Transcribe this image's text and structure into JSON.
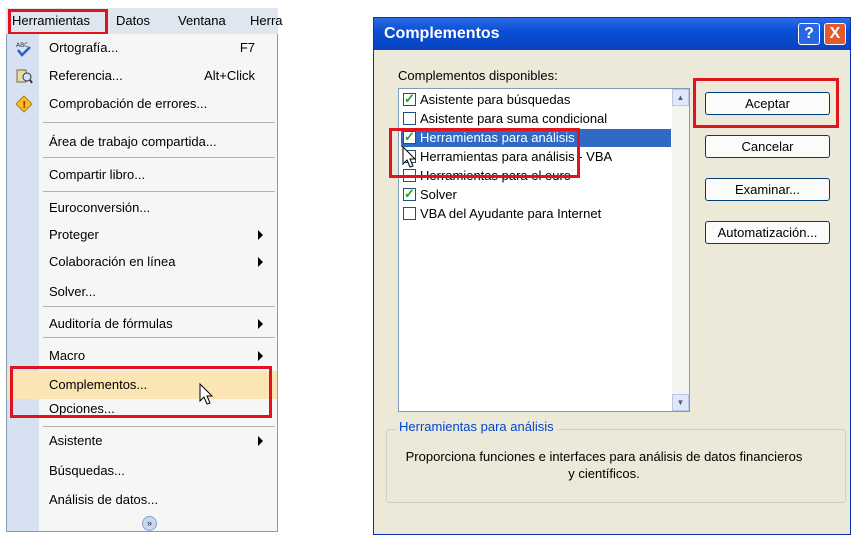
{
  "menubar": {
    "herramientas": "Herramientas",
    "datos": "Datos",
    "ventana": "Ventana",
    "truncated": "Herra"
  },
  "menu": {
    "items": [
      {
        "label": "Ortografía...",
        "shortcut": "F7",
        "icon": "spellcheck-icon"
      },
      {
        "label": "Referencia...",
        "shortcut": "Alt+Click",
        "icon": "research-icon"
      },
      {
        "label": "Comprobación de errores...",
        "icon": "error-check-icon"
      },
      {
        "label": "Área de trabajo compartida..."
      },
      {
        "label": "Compartir libro..."
      },
      {
        "label": "Euroconversión..."
      },
      {
        "label": "Proteger",
        "submenu": true
      },
      {
        "label": "Colaboración en línea",
        "submenu": true
      },
      {
        "label": "Solver..."
      },
      {
        "label": "Auditoría de fórmulas",
        "submenu": true
      },
      {
        "label": "Macro",
        "submenu": true
      },
      {
        "label": "Complementos..."
      },
      {
        "label": "Opciones..."
      },
      {
        "label": "Asistente",
        "submenu": true
      },
      {
        "label": "Búsquedas..."
      },
      {
        "label": "Análisis de datos..."
      }
    ],
    "expand_icon": "expand-menu-icon"
  },
  "dialog": {
    "title": "Complementos",
    "help": "?",
    "close": "X",
    "list_label": "Complementos disponibles:",
    "addins": [
      {
        "label": "Asistente para búsquedas",
        "checked": true
      },
      {
        "label": "Asistente para suma condicional",
        "checked": false
      },
      {
        "label": "Herramientas para análisis",
        "checked": true,
        "selected": true
      },
      {
        "label": "Herramientas para análisis - VBA",
        "checked": false
      },
      {
        "label": "Herramientas para el euro",
        "checked": false
      },
      {
        "label": "Solver",
        "checked": true
      },
      {
        "label": "VBA del Ayudante para Internet",
        "checked": false
      }
    ],
    "buttons": {
      "accept": "Aceptar",
      "cancel": "Cancelar",
      "browse": "Examinar...",
      "automation": "Automatización..."
    },
    "group_title": "Herramientas para análisis",
    "description": "Proporciona funciones e interfaces para análisis de datos financieros y científicos."
  },
  "colors": {
    "highlight_red": "#e0141e",
    "title_blue": "#0a4fd6",
    "selection_blue": "#316ac5",
    "menu_hover": "#fbe5b5"
  }
}
